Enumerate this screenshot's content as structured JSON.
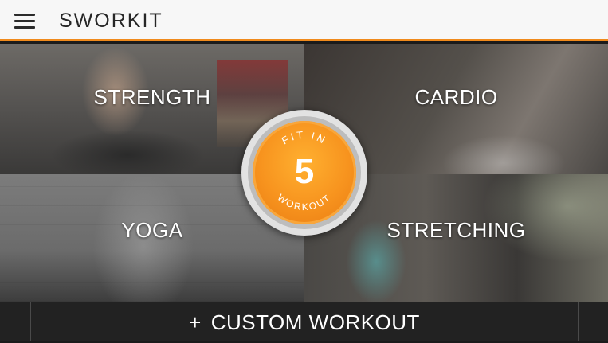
{
  "header": {
    "app_name": "SWORKIT",
    "menu_icon": "hamburger-menu-icon",
    "accent_color": "#f08a1c"
  },
  "tiles": [
    {
      "label": "STRENGTH"
    },
    {
      "label": "CARDIO"
    },
    {
      "label": "YOGA"
    },
    {
      "label": "STRETCHING"
    }
  ],
  "medallion": {
    "top_text": "FIT IN",
    "number": "5",
    "bottom_text": "WORKOUT",
    "color": "#f7931e"
  },
  "custom": {
    "icon": "plus-icon",
    "plus": "+",
    "label": "CUSTOM WORKOUT"
  }
}
